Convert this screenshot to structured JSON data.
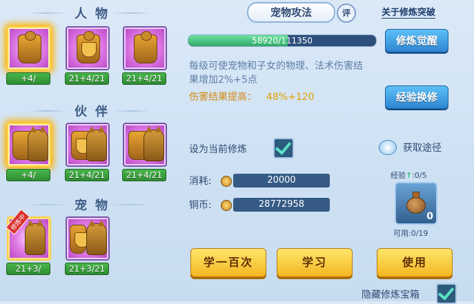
{
  "sections": {
    "characters_title": "人物",
    "partners_title": "伙伴",
    "pets_title": "宠物"
  },
  "characters": [
    {
      "count": "+4/"
    },
    {
      "count": "21+4/21"
    },
    {
      "count": "21+4/21"
    }
  ],
  "partners": [
    {
      "count": "+4/"
    },
    {
      "count": "21+4/21"
    },
    {
      "count": "21+4/21"
    }
  ],
  "pets": [
    {
      "count": "21+3/",
      "tag": "修炼中"
    },
    {
      "count": "21+3/21"
    }
  ],
  "skill": {
    "title": "宠物攻法",
    "review_label": "评",
    "breakthrough_link": "关于修炼突破",
    "progress_text": "58920/111350",
    "progress_fraction": 0.529,
    "awaken_button": "修炼觉醒",
    "description": "每级可使宠物和子女的物理、法术伤害结果增加2%+5点",
    "effect_label": "伤害结果提高：",
    "effect_value": "48%+120",
    "exchange_button": "经验换修"
  },
  "set_current": {
    "label": "设为当前修炼",
    "checked": true
  },
  "obtain": {
    "label": "获取途径"
  },
  "cost": {
    "consume_label": "消耗:",
    "consume_value": "20000",
    "copper_label": "铜币:",
    "copper_value": "28772958"
  },
  "treasure": {
    "exp_label": "经验",
    "exp_value": ":0/5",
    "count": "0",
    "usable": "可用:0/19"
  },
  "buttons": {
    "learn_hundred": "学一百次",
    "learn": "学习",
    "use": "使用"
  },
  "hide_box": {
    "label": "隐藏修炼宝箱",
    "checked": true
  },
  "colors": {
    "accent_blue": "#2d86d3",
    "gold": "#f3b521",
    "count_green": "#2f8c33"
  }
}
